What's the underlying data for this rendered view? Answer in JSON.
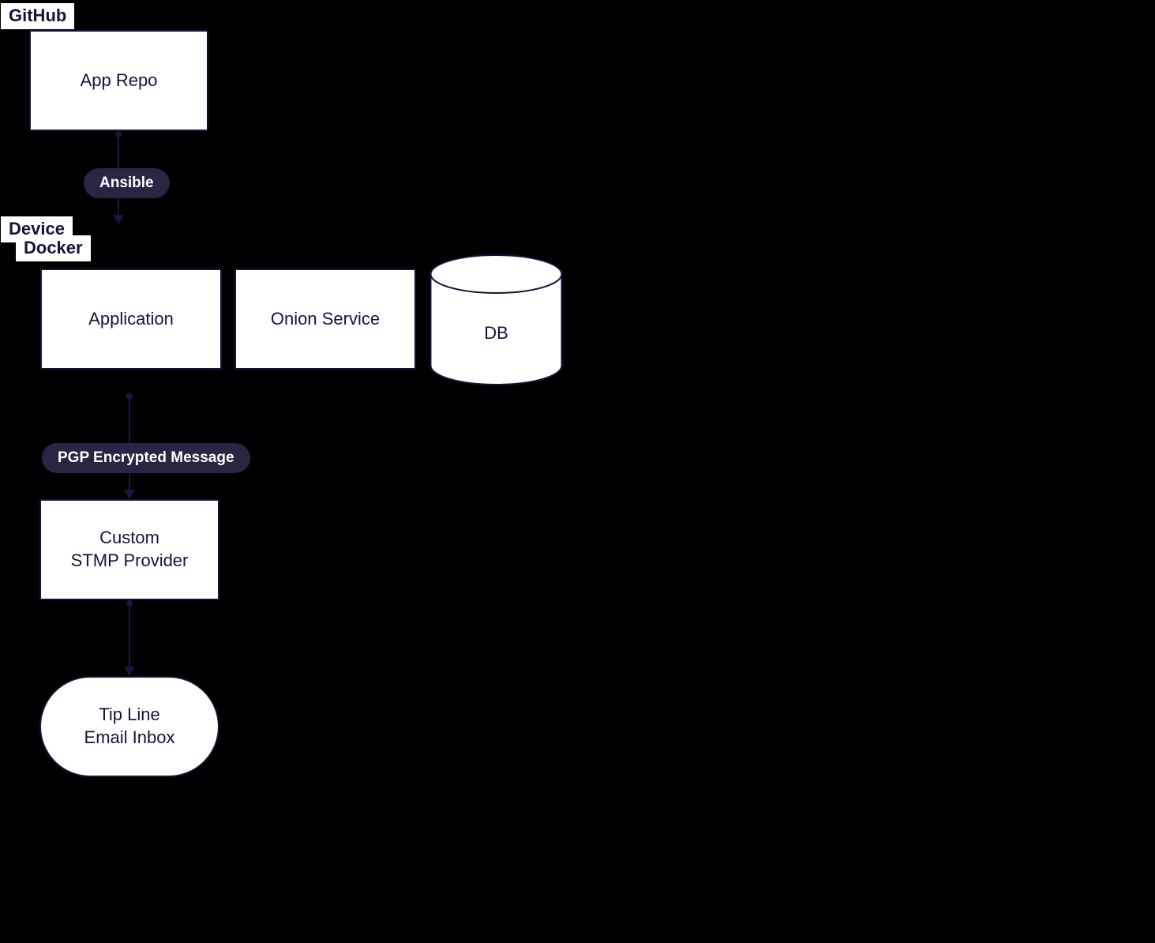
{
  "tags": {
    "github": "GitHub",
    "device": "Device",
    "docker": "Docker"
  },
  "nodes": {
    "app_repo": "App Repo",
    "application": "Application",
    "onion_service": "Onion Service",
    "db": "DB",
    "custom_smtp": "Custom\nSTMP Provider",
    "tip_line": "Tip Line\nEmail Inbox"
  },
  "edges": {
    "ansible": "Ansible",
    "pgp": "PGP Encrypted Message"
  }
}
